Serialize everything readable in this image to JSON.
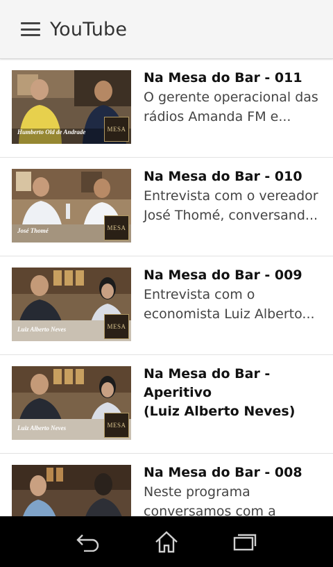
{
  "appbar": {
    "title": "YouTube",
    "menu_icon": "hamburger-menu-icon"
  },
  "videos": [
    {
      "title": "Na Mesa do Bar - 011",
      "desc_lines": [
        "O gerente operacional das",
        "rádios Amanda FM e..."
      ],
      "caption": "Humberto Old de Andrade",
      "logo": "MESA"
    },
    {
      "title": "Na Mesa do Bar - 010",
      "desc_lines": [
        "Entrevista com o vereador",
        "José Thomé, conversand..."
      ],
      "caption": "José Thomé",
      "logo": "MESA"
    },
    {
      "title": "Na Mesa do Bar - 009",
      "desc_lines": [
        "Entrevista com o",
        "economista Luiz Alberto..."
      ],
      "caption": "Luiz Alberto Neves",
      "logo": "MESA"
    },
    {
      "title_lines": [
        "Na Mesa do Bar - Aperitivo",
        "(Luiz Alberto Neves)"
      ],
      "caption": "Luiz Alberto Neves",
      "logo": "MESA"
    },
    {
      "title": "Na Mesa do Bar - 008",
      "desc_lines": [
        "Neste programa",
        "conversamos com a"
      ]
    }
  ],
  "navbar": {
    "back_icon": "back-icon",
    "home_icon": "home-icon",
    "recents_icon": "recent-apps-icon"
  },
  "colors": {
    "appbar_bg": "#f5f5f5",
    "navbar_bg": "#000000",
    "title_text": "#111111",
    "desc_text": "#444444"
  }
}
